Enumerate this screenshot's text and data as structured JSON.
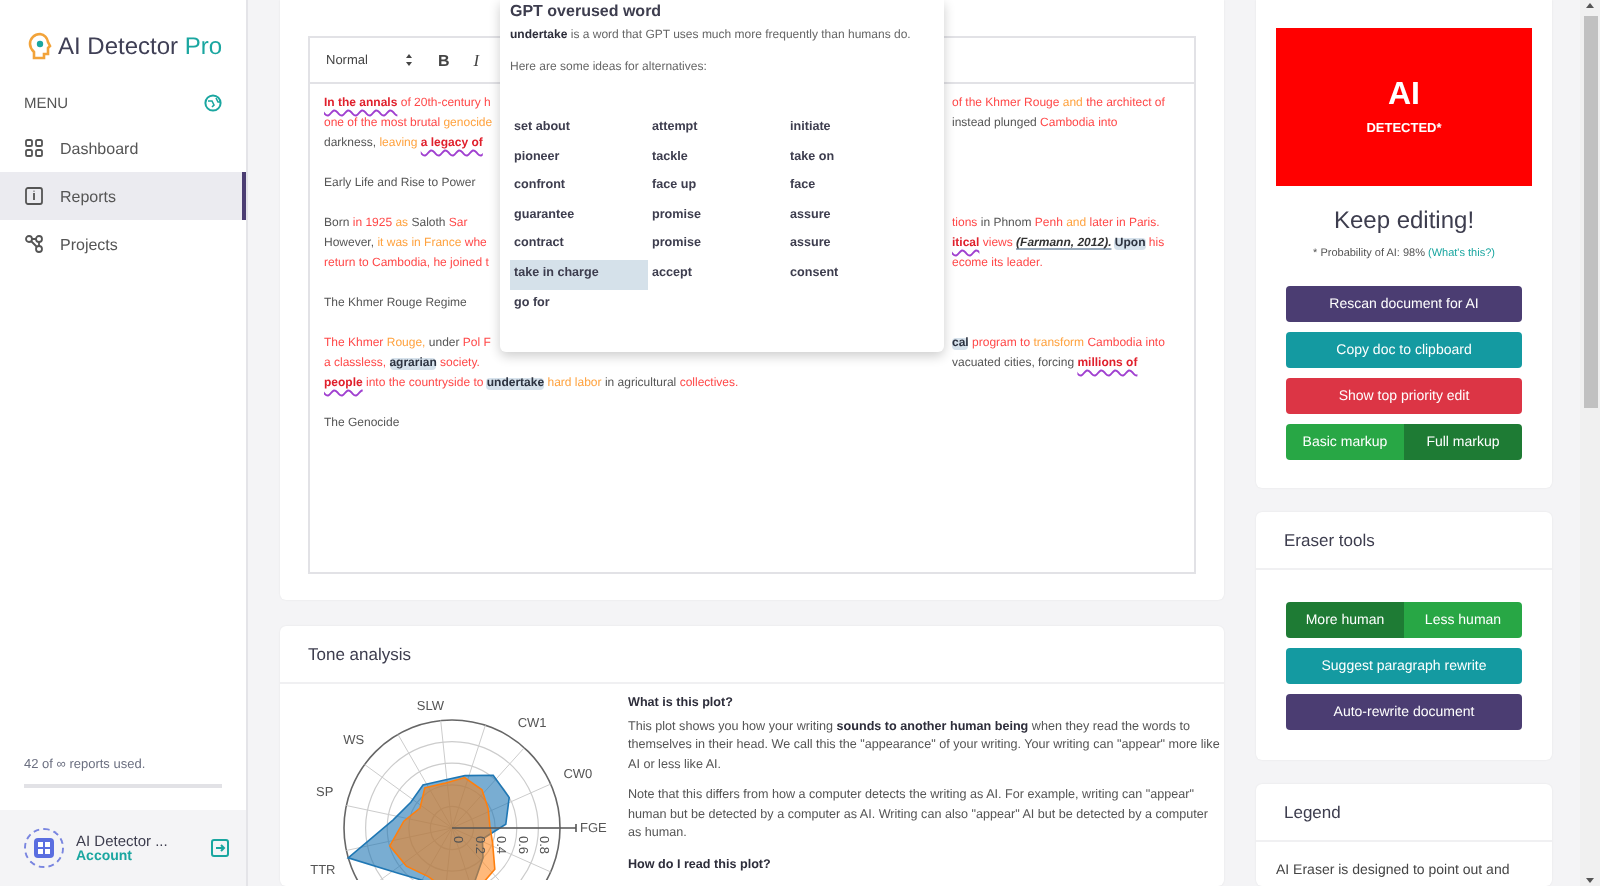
{
  "sidebar": {
    "brand": {
      "name": "AI Detector",
      "suffix": "Pro"
    },
    "menu_label": "MENU",
    "items": [
      {
        "label": "Dashboard",
        "selected": false
      },
      {
        "label": "Reports",
        "selected": true
      },
      {
        "label": "Projects",
        "selected": false
      }
    ],
    "usage": {
      "text": "42 of ∞ reports used."
    },
    "account": {
      "name": "AI Detector ...",
      "link": "Account"
    }
  },
  "editor": {
    "toolbar": {
      "style_select": "Normal",
      "bold": "B",
      "italic": "I"
    },
    "paragraphs": [
      {
        "lines": [
          {
            "left": [
              {
                "text": "In the annals",
                "kind": "flagged"
              },
              {
                "text": "of 20th-century h",
                "kind": "red"
              }
            ],
            "right": [
              {
                "text": "of the Khmer Rouge",
                "kind": "red"
              },
              {
                "text": "and",
                "kind": "orange"
              },
              {
                "text": "the architect of",
                "kind": "red"
              }
            ]
          },
          {
            "left": [
              {
                "text": "one of the most brutal",
                "kind": "red"
              },
              {
                "text": "genocide",
                "kind": "orange"
              }
            ],
            "right": [
              {
                "text": "instead plunged",
                "kind": "plain"
              },
              {
                "text": "Cambodia into",
                "kind": "red"
              }
            ]
          },
          {
            "left": [
              {
                "text": "darkness,",
                "kind": "plain"
              },
              {
                "text": "leaving",
                "kind": "orange"
              },
              {
                "text": "a legacy of",
                "kind": "flagged"
              }
            ]
          }
        ]
      },
      {
        "lines": [
          {
            "left": [
              {
                "text": "Early Life and Rise to Power",
                "kind": "plain"
              }
            ]
          }
        ]
      },
      {
        "lines": [
          {
            "left": [
              {
                "text": "Born",
                "kind": "plain"
              },
              {
                "text": "in 1925",
                "kind": "red"
              },
              {
                "text": "as",
                "kind": "orange"
              },
              {
                "text": "Saloth",
                "kind": "plain"
              },
              {
                "text": "Sar",
                "kind": "red"
              }
            ],
            "right": [
              {
                "text": "tions",
                "kind": "red"
              },
              {
                "text": "in Phnom",
                "kind": "plain"
              },
              {
                "text": "Penh",
                "kind": "red"
              },
              {
                "text": "and",
                "kind": "orange"
              },
              {
                "text": "later in Paris.",
                "kind": "red"
              }
            ]
          },
          {
            "left": [
              {
                "text": "However,",
                "kind": "plain"
              },
              {
                "text": "it was in France",
                "kind": "orange"
              },
              {
                "text": "whe",
                "kind": "red"
              }
            ],
            "right": [
              {
                "text": "itical",
                "kind": "flagged"
              },
              {
                "text": "views",
                "kind": "red"
              },
              {
                "text": "(Farmann, 2012).",
                "kind": "cited"
              },
              {
                "text": "Upon",
                "kind": "marked"
              },
              {
                "text": "his",
                "kind": "red"
              }
            ]
          },
          {
            "left": [
              {
                "text": "return to Cambodia, he joined t",
                "kind": "red"
              }
            ],
            "right": [
              {
                "text": "ecome its leader.",
                "kind": "red"
              }
            ]
          }
        ]
      },
      {
        "lines": [
          {
            "left": [
              {
                "text": "The Khmer Rouge Regime",
                "kind": "plain"
              }
            ]
          }
        ]
      },
      {
        "lines": [
          {
            "left": [
              {
                "text": "The Khmer",
                "kind": "red"
              },
              {
                "text": "Rouge,",
                "kind": "orange"
              },
              {
                "text": "under",
                "kind": "plain"
              },
              {
                "text": "Pol F",
                "kind": "red"
              }
            ],
            "right": [
              {
                "text": "cal",
                "kind": "marked"
              },
              {
                "text": "program to",
                "kind": "red"
              },
              {
                "text": "transform",
                "kind": "orange"
              },
              {
                "text": "Cambodia into",
                "kind": "red"
              }
            ]
          },
          {
            "left": [
              {
                "text": "a classless,",
                "kind": "red"
              },
              {
                "text": "agrarian",
                "kind": "marked"
              },
              {
                "text": "society.",
                "kind": "red"
              }
            ],
            "right": [
              {
                "text": "vacuated cities, forcing",
                "kind": "plain"
              },
              {
                "text": "millions of",
                "kind": "flagged"
              }
            ]
          },
          {
            "left": [
              {
                "text": "people",
                "kind": "flagged"
              },
              {
                "text": "into the countryside to",
                "kind": "red"
              },
              {
                "text": "undertake",
                "kind": "marked"
              },
              {
                "text": "hard labor",
                "kind": "orange"
              },
              {
                "text": "in agricultural",
                "kind": "plain"
              },
              {
                "text": "collectives.",
                "kind": "red"
              }
            ]
          }
        ]
      },
      {
        "lines": [
          {
            "left": [
              {
                "text": "The Genocide",
                "kind": "plain"
              }
            ]
          }
        ]
      }
    ]
  },
  "popup": {
    "title": "GPT overused word",
    "description": "**undertake** is a word that GPT uses much more frequently than humans do.",
    "prompt": "Here are some ideas for alternatives:",
    "alternatives": [
      {
        "label": "set about",
        "selected": false
      },
      {
        "label": "attempt",
        "selected": false
      },
      {
        "label": "initiate",
        "selected": false
      },
      {
        "label": "pioneer",
        "selected": false
      },
      {
        "label": "tackle",
        "selected": false
      },
      {
        "label": "take on",
        "selected": false
      },
      {
        "label": "confront",
        "selected": false
      },
      {
        "label": "face up",
        "selected": false
      },
      {
        "label": "face",
        "selected": false
      },
      {
        "label": "guarantee",
        "selected": false
      },
      {
        "label": "promise",
        "selected": false
      },
      {
        "label": "assure",
        "selected": false
      },
      {
        "label": "contract",
        "selected": false
      },
      {
        "label": "promise",
        "selected": false
      },
      {
        "label": "assure",
        "selected": false
      },
      {
        "label": "take in charge",
        "selected": true
      },
      {
        "label": "accept",
        "selected": false
      },
      {
        "label": "consent",
        "selected": false
      },
      {
        "label": "go for",
        "selected": false
      }
    ]
  },
  "tone": {
    "title": "Tone analysis",
    "plot": {
      "axes": [
        "SLW",
        "CW1",
        "CW0",
        "FGE",
        "TTR",
        "SP",
        "WS"
      ],
      "ticks": [
        "0",
        "0.2",
        "0.4",
        "0.6",
        "0.8"
      ]
    },
    "paragraphs": [
      {
        "kind": "heading",
        "text": "What is this plot?"
      },
      {
        "kind": "body",
        "text": "This plot shows you how your writing **sounds to another human being** when they read the words to themselves in their head. We call this the \"appearance\" of your writing. Your writing can \"appear\" more like AI or less like AI."
      },
      {
        "kind": "body",
        "text": "Note that this differs from how a computer detects the writing as AI. For example, writing can \"appear\" human but be detected by a computer as AI. Writing can also \"appear\" AI but be detected by a computer as human."
      },
      {
        "kind": "heading",
        "text": "How do I read this plot?"
      }
    ]
  },
  "detection": {
    "verdict": "AI",
    "verdict_sub": "DETECTED*",
    "status": "Keep editing!",
    "probability": "* Probability of AI: 98%",
    "help_link": "(What's this?)",
    "actions": [
      {
        "label": "Rescan document for AI",
        "kind": "primary"
      },
      {
        "label": "Copy doc to clipboard",
        "kind": "info"
      },
      {
        "label": "Show top priority edit",
        "kind": "danger"
      }
    ],
    "markup_toggle": [
      {
        "label": "Basic markup",
        "selected": false
      },
      {
        "label": "Full markup",
        "selected": true
      }
    ]
  },
  "eraser": {
    "title": "Eraser tools",
    "direction_toggle": [
      {
        "label": "More human",
        "selected": true
      },
      {
        "label": "Less human",
        "selected": false
      }
    ],
    "actions": [
      {
        "label": "Suggest paragraph rewrite",
        "kind": "info"
      },
      {
        "label": "Auto-rewrite document",
        "kind": "primary"
      }
    ]
  },
  "legend": {
    "title": "Legend",
    "text": "AI Eraser is designed to point out and"
  }
}
